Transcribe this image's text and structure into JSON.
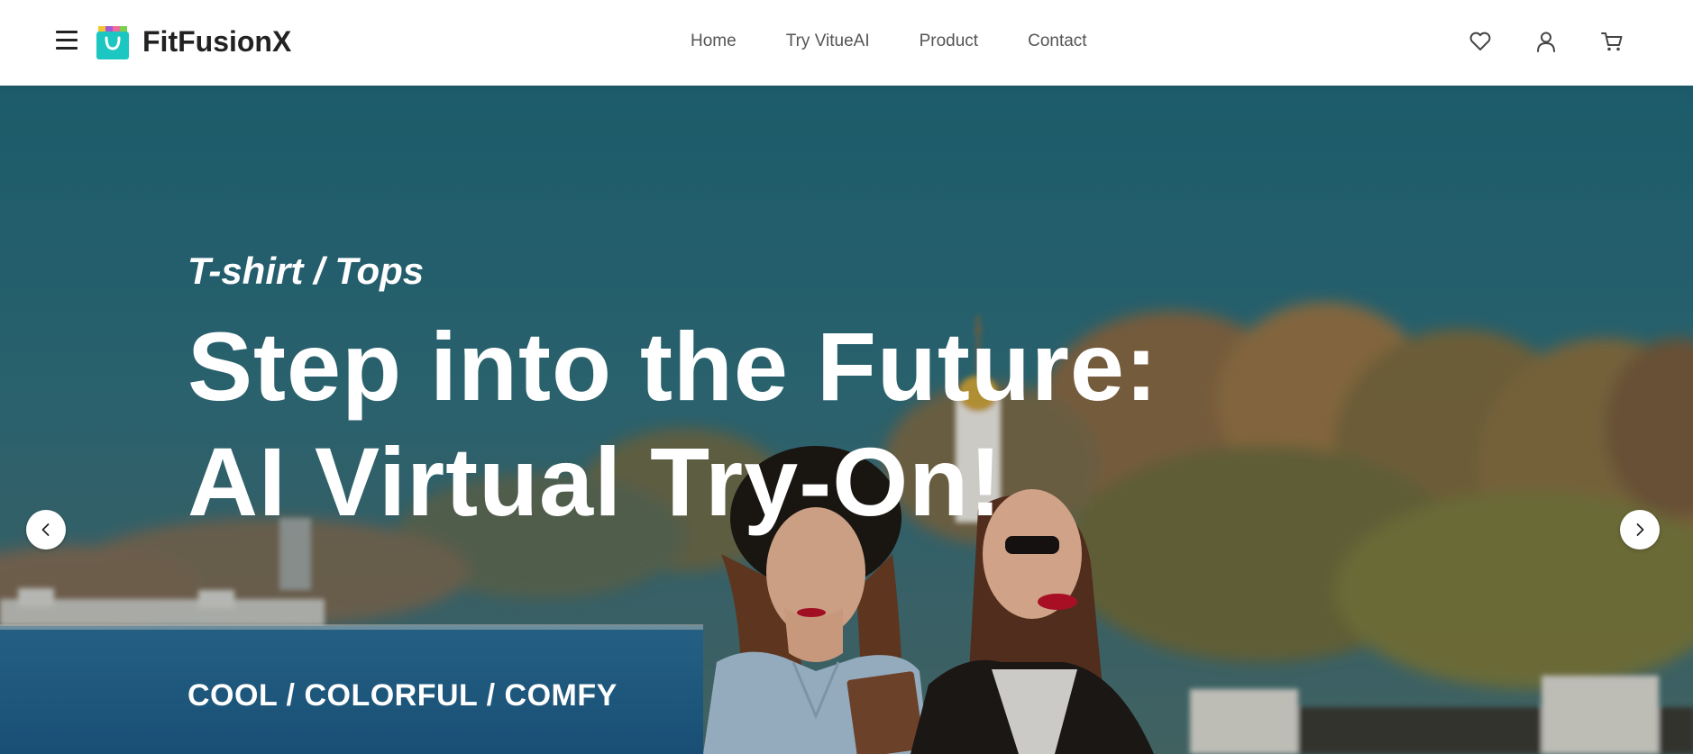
{
  "header": {
    "brand": "FitFusionX",
    "nav": [
      "Home",
      "Try VitueAI",
      "Product",
      "Contact"
    ],
    "icons": [
      "menu-icon",
      "shopping-bag-logo-icon",
      "heart-icon",
      "user-icon",
      "cart-icon"
    ]
  },
  "hero": {
    "category": "T-shirt / Tops",
    "headline": "Step into the Future: AI Virtual Try-On!",
    "tagline": "COOL / COLORFUL / COMFY",
    "prev_icon": "chevron-left-icon",
    "next_icon": "chevron-right-icon"
  },
  "colors": {
    "logo_teal": "#1cc7c1",
    "sky_teal": "#2b6d7a",
    "text_dark": "#222222",
    "nav_text": "#555555"
  }
}
